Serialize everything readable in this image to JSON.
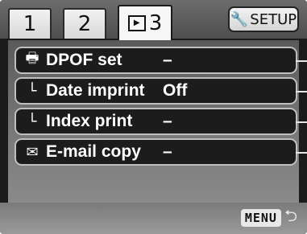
{
  "tabs": [
    {
      "label": "1"
    },
    {
      "label": "2"
    },
    {
      "label": "3",
      "icon": "playback-icon"
    }
  ],
  "setup": {
    "label": "SETUP",
    "icon": "wrench-icon"
  },
  "menu": {
    "items": [
      {
        "icon": "printer-icon",
        "glyph": "🖶",
        "label": "DPOF set",
        "value": "–"
      },
      {
        "icon": "sub-item-icon",
        "glyph": "└",
        "label": "Date imprint",
        "value": "Off"
      },
      {
        "icon": "sub-item-icon",
        "glyph": "└",
        "label": "Index print",
        "value": "–"
      },
      {
        "icon": "envelope-icon",
        "glyph": "✉",
        "label": "E-mail copy",
        "value": "–"
      }
    ]
  },
  "footer": {
    "menu_label": "MENU",
    "back_icon": "return-arrow-icon"
  }
}
